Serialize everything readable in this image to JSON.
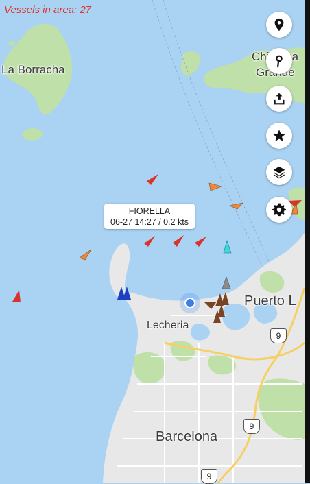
{
  "status": {
    "vessels_label": "Vessels in area: 27"
  },
  "places": {
    "la_borracha": "La Borracha",
    "chimana_line1": "Chimana",
    "chimana_line2": "Grande",
    "puerto": "Puerto L",
    "lecheria": "Lecheria",
    "barcelona": "Barcelona"
  },
  "roads": {
    "shield_a": "9",
    "shield_b": "9",
    "shield_c": "9"
  },
  "popup": {
    "name": "FIORELLA",
    "details": "06-27 14:27 / 0.2 kts"
  },
  "toolbar": [
    {
      "icon": "location-pin-icon"
    },
    {
      "icon": "pin-drop-icon"
    },
    {
      "icon": "share-upload-icon"
    },
    {
      "icon": "star-icon"
    },
    {
      "icon": "layers-icon"
    },
    {
      "icon": "gear-icon"
    }
  ],
  "colors": {
    "water": "#a9d2f3",
    "land": "#e8e8e8",
    "vegetation": "#b9dfa3",
    "vessel_red": "#d9342b",
    "vessel_orange": "#f0883a",
    "vessel_cyan": "#3fd6dc",
    "vessel_blue": "#1c3fc4",
    "vessel_brown": "#7a4326",
    "vessel_grey": "#8a8a8a",
    "accent_text": "#e0342c"
  }
}
